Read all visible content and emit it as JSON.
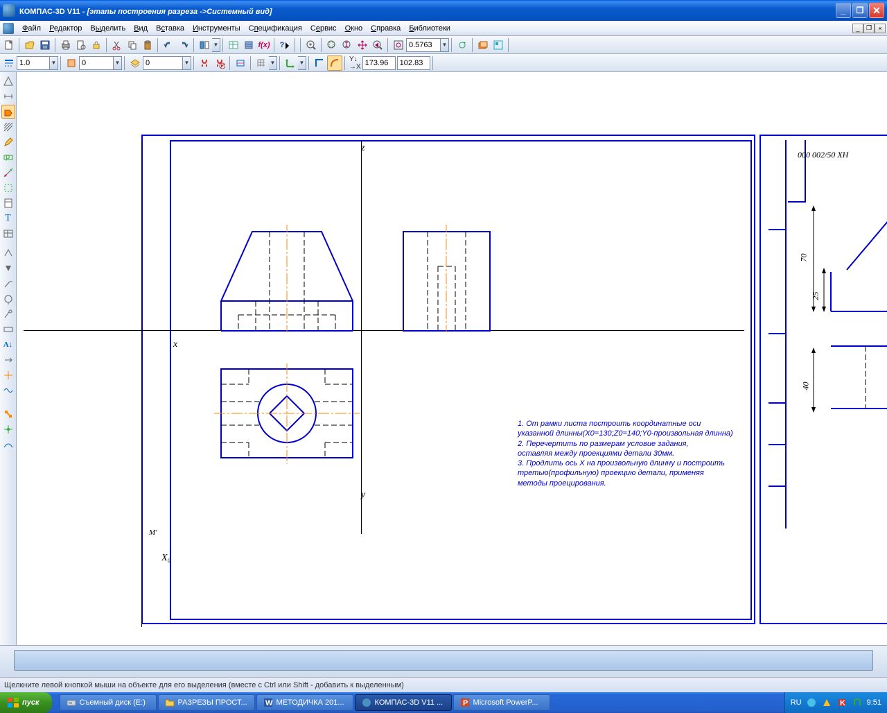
{
  "title": {
    "app": "КОМПАС-3D V11",
    "sep": " - ",
    "doc": "[этапы построения разреза ->Системный вид]"
  },
  "menu": [
    "Файл",
    "Редактор",
    "Выделить",
    "Вид",
    "Вставка",
    "Инструменты",
    "Спецификация",
    "Сервис",
    "Окно",
    "Справка",
    "Библиотеки"
  ],
  "menu_ul": [
    "Ф",
    "Р",
    "ы",
    "В",
    "с",
    "И",
    "п",
    "е",
    "О",
    "С",
    "Б"
  ],
  "toolbar1": {
    "zoom": "0.5763"
  },
  "toolbar2": {
    "style1": "1.0",
    "style2": "0",
    "layer": "0",
    "x": "173.96",
    "y": "102.83"
  },
  "axis": {
    "x": "x",
    "y": "y",
    "z": "z"
  },
  "notes": [
    "1. От рамки листа построить координатные оси",
    "указанной длинны(X0=130;Z0=140;Y0-произвольная длинна)",
    "2. Перечертить по размерам условие задания,",
    "оставляя между проекциями детали 30мм.",
    "3. Продлить ось X на произвольную длинну и построить",
    "третью(профильную) проекцию детали, применяя",
    "методы проецирования."
  ],
  "dims": {
    "d1": "70",
    "d2": "25",
    "d3": "40"
  },
  "side_text": "000 002/50 XH",
  "status": "Щелкните левой кнопкой мыши на объекте для его выделения (вместе с Ctrl или Shift - добавить к выделенным)",
  "start": "пуск",
  "tasks": [
    {
      "label": "Съемный диск (E:)",
      "icon": "disk"
    },
    {
      "label": "РАЗРЕЗЫ ПРОСТ...",
      "icon": "folder"
    },
    {
      "label": "МЕТОДИЧКА 201...",
      "icon": "word"
    },
    {
      "label": "КОМПАС-3D V11 ...",
      "icon": "kompas",
      "active": true
    },
    {
      "label": "Microsoft PowerP...",
      "icon": "ppt"
    }
  ],
  "tray": {
    "lang": "RU",
    "time": "9:51"
  }
}
